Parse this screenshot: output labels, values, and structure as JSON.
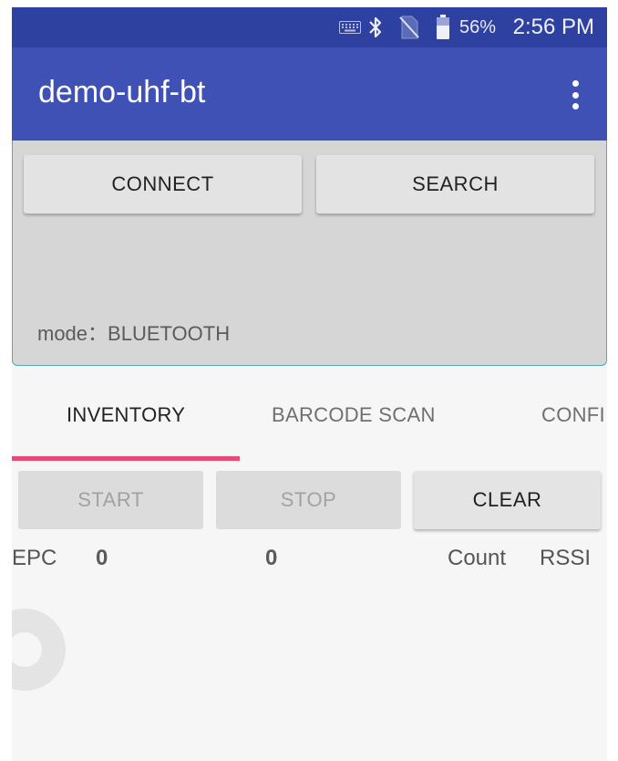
{
  "status_bar": {
    "battery_percent": "56%",
    "time": "2:56 PM",
    "icons": [
      "keyboard-icon",
      "bluetooth-icon",
      "no-sim-icon",
      "battery-icon"
    ]
  },
  "app_bar": {
    "title": "demo-uhf-bt",
    "menu_icon": "more-vert-icon"
  },
  "connect_panel": {
    "connect_label": "CONNECT",
    "search_label": "SEARCH",
    "mode_text": "mode：BLUETOOTH"
  },
  "tabs": [
    {
      "label": "INVENTORY",
      "selected": true
    },
    {
      "label": "BARCODE SCAN",
      "selected": false
    },
    {
      "label": "CONFI",
      "selected": false
    }
  ],
  "actions": {
    "start_label": "START",
    "stop_label": "STOP",
    "clear_label": "CLEAR"
  },
  "table_header": {
    "epc_label": "EPC",
    "tag_count": "0",
    "read_count": "0",
    "count_label": "Count",
    "rssi_label": "RSSI"
  },
  "colors": {
    "status_bar": "#2f41a0",
    "app_bar": "#3f51b5",
    "tab_indicator": "#e84a78",
    "panel_bg": "#d6d6d6"
  }
}
